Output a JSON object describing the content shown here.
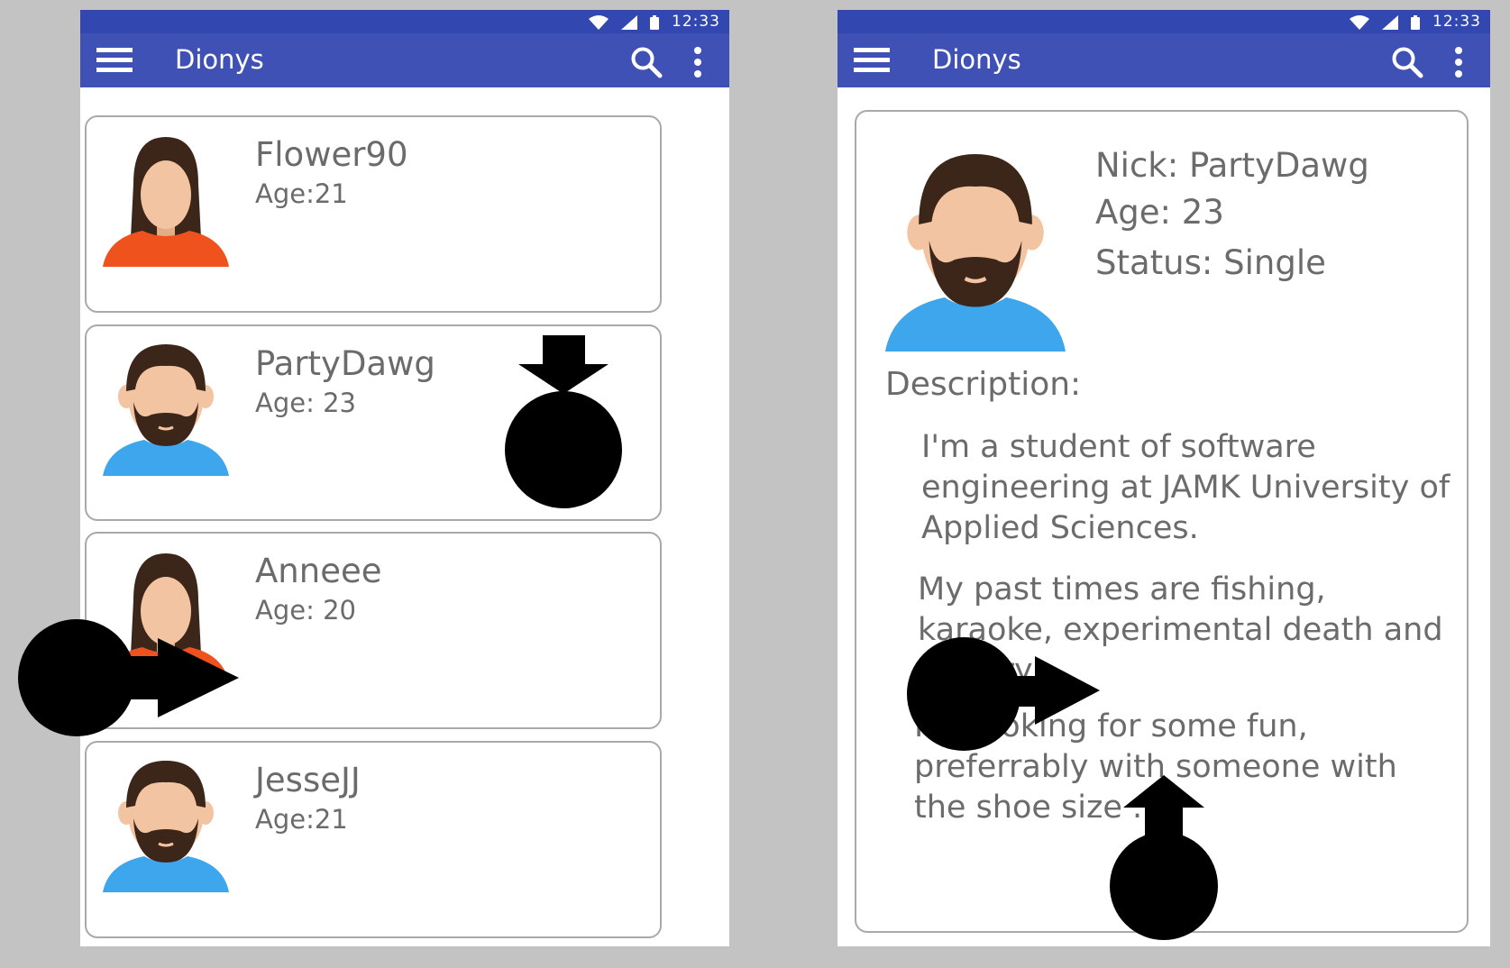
{
  "status_bar": {
    "time": "12:33"
  },
  "app_bar": {
    "title": "Dionys"
  },
  "profile_list": [
    {
      "name": "Flower90",
      "age": "Age:21",
      "avatar": "female-avatar-icon"
    },
    {
      "name": "PartyDawg",
      "age": "Age: 23",
      "avatar": "male-avatar-icon"
    },
    {
      "name": "Anneee",
      "age": "Age: 20",
      "avatar": "female-avatar-icon"
    },
    {
      "name": "JesseJJ",
      "age": "Age:21",
      "avatar": "male-avatar-icon"
    }
  ],
  "profile_detail": {
    "nick": "Nick: PartyDawg",
    "age": "Age: 23",
    "status": "Status: Single",
    "description_label": "Description:",
    "paragraphs": [
      "I'm a student of software engineering at JAMK University of Applied Sciences.",
      "My past times are fishing, karaoke, experimental death and pottery.",
      "I'm looking for some fun, preferrably with someone with the shoe size ."
    ]
  },
  "colors": {
    "app_bar": "#3f51b5",
    "status_bar": "#3247b0",
    "text": "#6b6b6b",
    "card_border": "#a9a9a9",
    "female_shirt": "#f0521d",
    "male_shirt": "#3ea6ec",
    "skin": "#f3c4a1",
    "hair": "#3c2519"
  }
}
